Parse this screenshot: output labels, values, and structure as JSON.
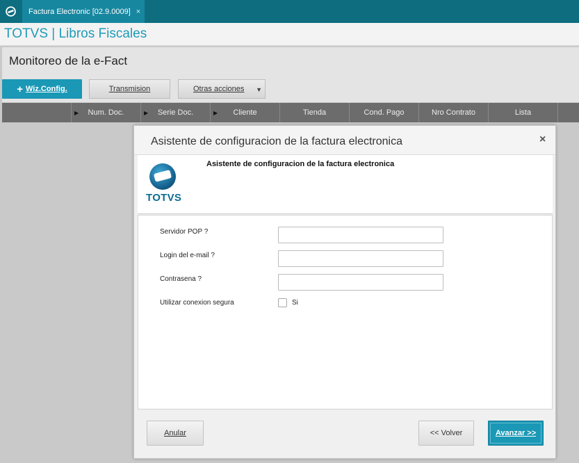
{
  "tabbar": {
    "tab_label": "Factura Electronic [02.9.0009]",
    "tab_close": "×"
  },
  "module": {
    "title": "TOTVS | Libros Fiscales"
  },
  "page": {
    "title": "Monitoreo de la e-Fact",
    "toolbar": {
      "wiz_plus": "+",
      "wiz_label": "Wiz.Config.",
      "transmision_label": "Transmision",
      "otras_label": "Otras acciones",
      "otras_caret": "▼"
    },
    "grid_columns": [
      "",
      "Num. Doc.",
      "Serie Doc.",
      "Cliente",
      "Tienda",
      "Cond. Pago",
      "Nro Contrato",
      "Lista"
    ]
  },
  "dialog": {
    "title": "Asistente de configuracion de la factura electronica",
    "close": "×",
    "banner_title": "Asistente de configuracion de la factura electronica",
    "logo_text": "TOTVS",
    "fields": {
      "pop_label": "Servidor POP ?",
      "pop_value": "",
      "login_label": "Login del e-mail  ?",
      "login_value": "",
      "password_label": "Contrasena ?",
      "password_value": "",
      "secure_label": "Utilizar conexion segura",
      "secure_option": "Si",
      "secure_checked": false
    },
    "buttons": {
      "anular": "Anular",
      "volver": "<< Volver",
      "avanzar": "Avanzar >>"
    }
  },
  "colors": {
    "topbar": "#0e6e80",
    "accent": "#1a98b6",
    "module_title": "#1f9bb8",
    "grid_header": "#6c6c6c"
  }
}
